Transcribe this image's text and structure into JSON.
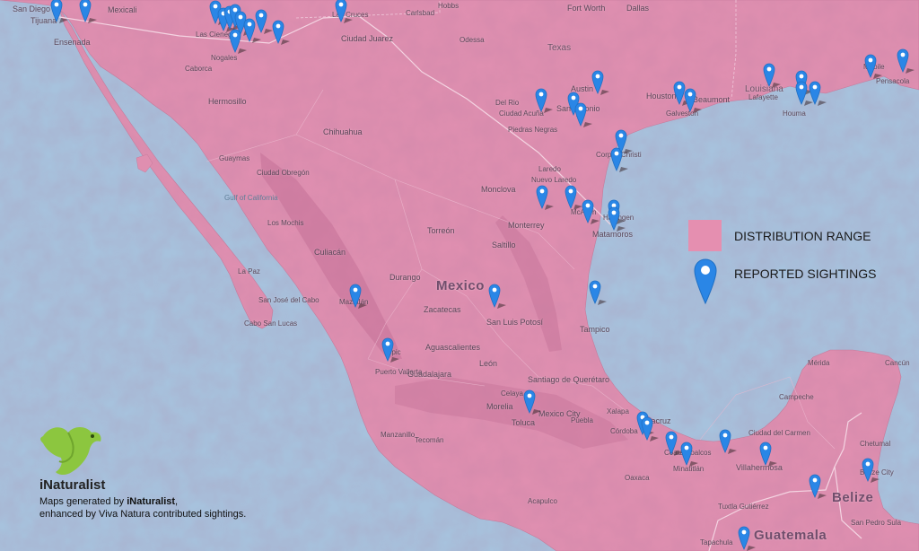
{
  "legend": {
    "distribution_label": "DISTRIBUTION RANGE",
    "sightings_label": "REPORTED SIGHTINGS",
    "distribution_color": "#e58fb0",
    "pin_color": "#2a86e6"
  },
  "branding": {
    "logo_text": "iNaturalist",
    "credit_line1_prefix": "Maps generated by ",
    "credit_line1_brand": "iNaturalist",
    "credit_line1_suffix": ",",
    "credit_line2": "enhanced by Viva Natura contributed sightings."
  },
  "labels": {
    "country_mexico": "Mexico",
    "country_belize": "Belize",
    "country_guatemala": "Guatemala",
    "state_texas": "Texas",
    "state_louisiana": "Louisiana",
    "gulf_of_california": "Gulf of California",
    "cities": {
      "san_diego": "San Diego",
      "tijuana": "Tijuana",
      "ensenada": "Ensenada",
      "mexicali": "Mexicali",
      "las_cienega": "Las Cienega",
      "nogales": "Nogales",
      "las_cruces": "Las Cruces",
      "carlsbad": "Carlsbad",
      "hobbs": "Hobbs",
      "fort_worth": "Fort Worth",
      "dallas": "Dallas",
      "ciudad_juarez": "Ciudad Juarez",
      "odessa": "Odessa",
      "caborca": "Caborca",
      "hermosillo": "Hermosillo",
      "chihuahua": "Chihuahua",
      "guaymas": "Guaymas",
      "ciudad_obregon": "Ciudad Obregón",
      "los_mochis": "Los Mochis",
      "culiacan": "Culiacán",
      "la_paz": "La Paz",
      "cabo_san_lucas": "Cabo San Lucas",
      "san_jose_del_cabo": "San José del Cabo",
      "mazatlan": "Mazatlán",
      "durango": "Durango",
      "torreon": "Torreón",
      "monclova": "Monclova",
      "monterrey": "Monterrey",
      "saltillo": "Saltillo",
      "matamoros": "Matamoros",
      "mcallen": "McAllen",
      "harlingen": "Harlingen",
      "laredo": "Laredo",
      "nuevo_laredo": "Nuevo Laredo",
      "corpus_christi": "Corpus Christi",
      "san_antonio": "San Antonio",
      "austin": "Austin",
      "houston": "Houston",
      "galveston": "Galveston",
      "beaumont": "Beaumont",
      "del_rio": "Del Rio",
      "ciudad_acuna": "Ciudad Acuña",
      "piedras_negras": "Piedras Negras",
      "zacatecas": "Zacatecas",
      "san_luis_potosi": "San Luis Potosí",
      "aguascalientes": "Aguascalientes",
      "leon": "León",
      "guadalajara": "Guadalajara",
      "tepic": "Tepic",
      "puerto_vallarta": "Puerto Vallarta",
      "manzanillo": "Manzanillo",
      "tecoman": "Tecomán",
      "morelia": "Morelia",
      "celaya": "Celaya",
      "santiago_de_queretaro": "Santiago de Querétaro",
      "toluca": "Toluca",
      "mexico_city": "Mexico City",
      "puebla": "Puebla",
      "cordoba": "Córdoba",
      "xalapa": "Xalapa",
      "veracruz": "Veracruz",
      "tampico": "Tampico",
      "acapulco": "Acapulco",
      "oaxaca": "Oaxaca",
      "coatzacoalcos": "Coatzacoalcos",
      "minatitlan": "Minatitlán",
      "villahermosa": "Villahermosa",
      "ciudad_del_carmen": "Ciudad del Carmen",
      "campeche": "Campeche",
      "merida": "Mérida",
      "cancun": "Cancún",
      "chetumal": "Chetumal",
      "belize_city": "Belize City",
      "tuxtla_gutierrez": "Tuxtla Gutiérrez",
      "tapachula": "Tapachula",
      "san_pedro_sula": "San Pedro Sula",
      "houma": "Houma",
      "pensacola": "Pensacola",
      "mobile": "Mobile",
      "lafayette": "Lafayette"
    }
  }
}
